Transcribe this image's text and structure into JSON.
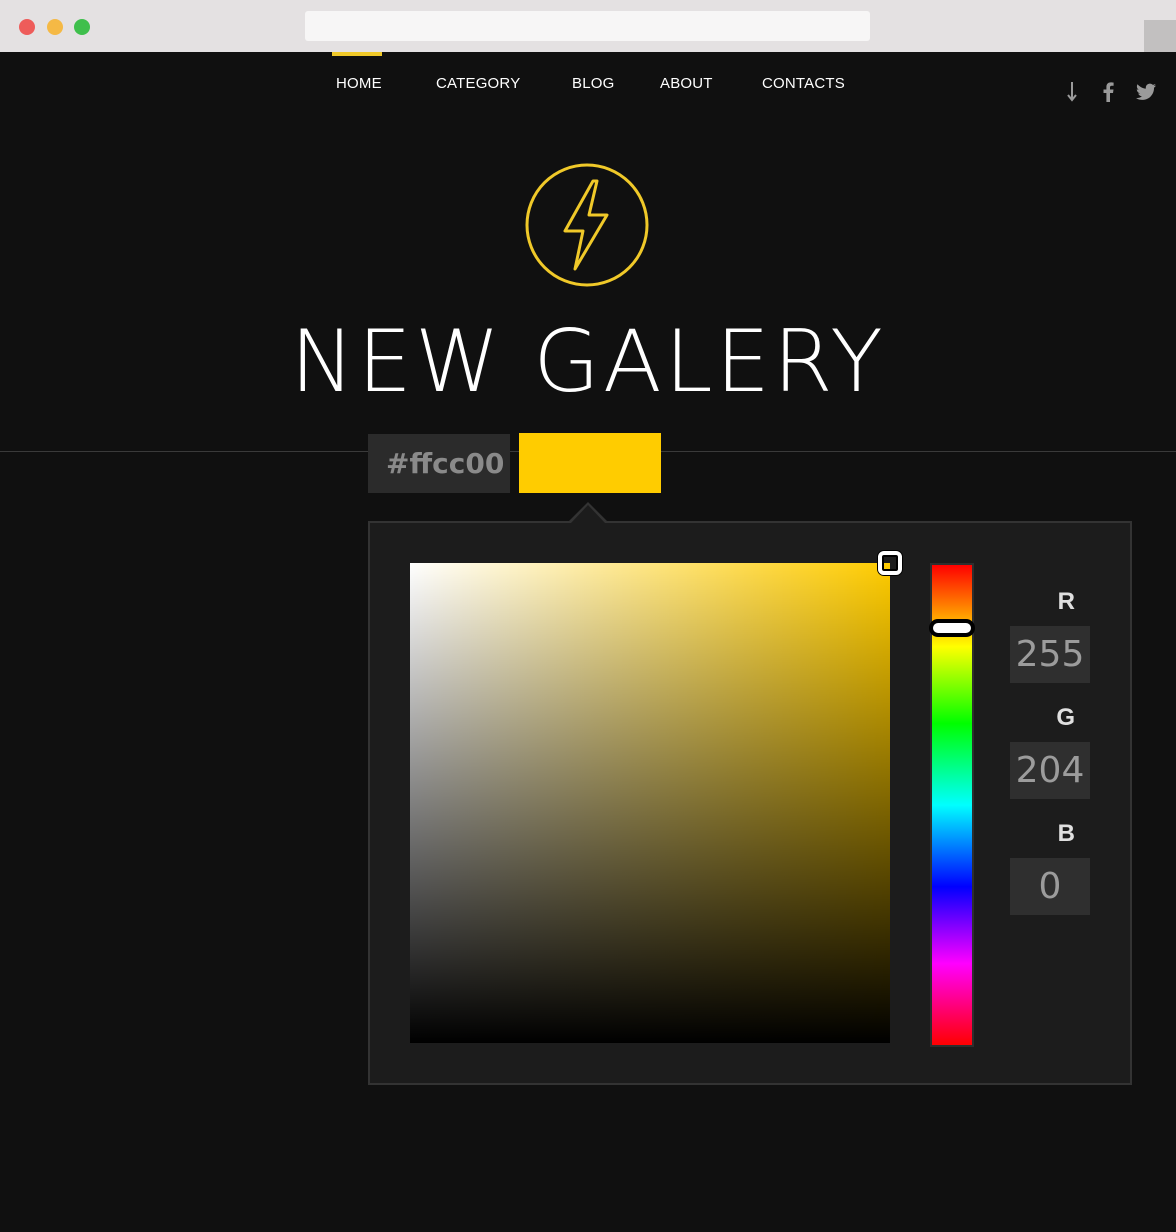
{
  "nav": {
    "items": [
      {
        "label": "HOME",
        "active": true
      },
      {
        "label": "CATEGORY"
      },
      {
        "label": "BLOG"
      },
      {
        "label": "ABOUT"
      },
      {
        "label": "CONTACTS"
      }
    ],
    "indicator_color": "#f0c929",
    "social_icons": [
      "download-icon",
      "facebook-icon",
      "twitter-icon"
    ]
  },
  "hero": {
    "logo_icon": "lightning-bolt-icon",
    "logo_color": "#f0c929",
    "title": "NEW GALERY"
  },
  "color_input": {
    "hex_value": "#ffcc00",
    "swatch_color": "#ffcc00"
  },
  "picker": {
    "hue_color": "#ffcc00",
    "channels": [
      {
        "label": "R",
        "value": "255"
      },
      {
        "label": "G",
        "value": "204"
      },
      {
        "label": "B",
        "value": "0"
      }
    ]
  }
}
